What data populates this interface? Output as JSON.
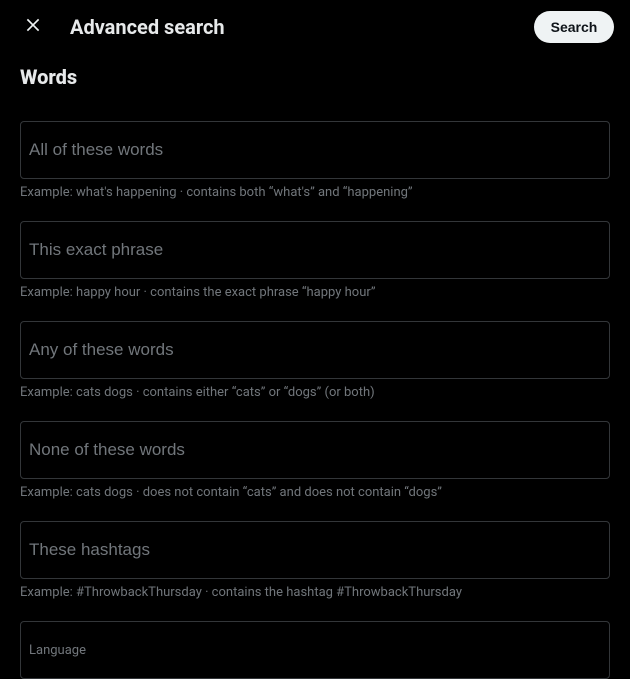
{
  "header": {
    "title": "Advanced search",
    "search_button": "Search"
  },
  "section_title": "Words",
  "fields": {
    "all_words": {
      "placeholder": "All of these words",
      "example": "Example: what's happening · contains both “what's” and “happening”"
    },
    "exact_phrase": {
      "placeholder": "This exact phrase",
      "example": "Example: happy hour · contains the exact phrase “happy hour”"
    },
    "any_words": {
      "placeholder": "Any of these words",
      "example": "Example: cats dogs · contains either “cats” or “dogs” (or both)"
    },
    "none_words": {
      "placeholder": "None of these words",
      "example": "Example: cats dogs · does not contain “cats” and does not contain “dogs”"
    },
    "hashtags": {
      "placeholder": "These hashtags",
      "example": "Example: #ThrowbackThursday · contains the hashtag #ThrowbackThursday"
    },
    "language": {
      "label": "Language"
    }
  }
}
